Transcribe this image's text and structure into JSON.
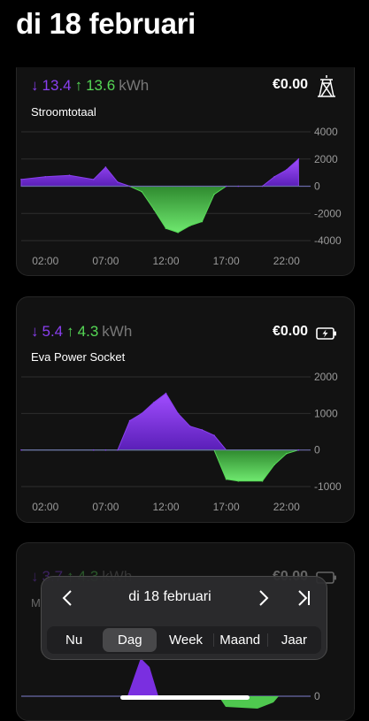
{
  "page": {
    "title": "di 18 februari"
  },
  "cards": [
    {
      "down": "13.4",
      "up": "13.6",
      "unit": "kWh",
      "price": "€0.00",
      "name": "Stroomtotaal",
      "icon": "power-pylon-icon",
      "chart": {
        "yticks": [
          "4000",
          "2000",
          "0",
          "-2000",
          "-4000"
        ],
        "xticks": [
          "02:00",
          "07:00",
          "12:00",
          "17:00",
          "22:00"
        ]
      }
    },
    {
      "down": "5.4",
      "up": "4.3",
      "unit": "kWh",
      "price": "€0.00",
      "name": "Eva Power Socket",
      "icon": "battery-charging-icon",
      "chart": {
        "yticks": [
          "2000",
          "1000",
          "0",
          "-1000"
        ],
        "xticks": [
          "02:00",
          "07:00",
          "12:00",
          "17:00",
          "22:00"
        ]
      }
    },
    {
      "down": "3.7",
      "up": "4.3",
      "unit": "kWh",
      "price": "€0.00",
      "name": "M",
      "icon": "battery-charging-icon",
      "chart": {
        "yticks": [
          "0"
        ]
      }
    }
  ],
  "chart_data": [
    {
      "type": "area",
      "title": "Stroomtotaal",
      "ylim": [
        -4000,
        4000
      ],
      "xlabel": "",
      "ylabel": "",
      "x": [
        "00:00",
        "02:00",
        "04:00",
        "06:00",
        "07:00",
        "08:00",
        "09:00",
        "10:00",
        "11:00",
        "12:00",
        "13:00",
        "14:00",
        "15:00",
        "16:00",
        "17:00",
        "18:00",
        "20:00",
        "21:00",
        "22:00",
        "23:00"
      ],
      "values": [
        500,
        700,
        800,
        500,
        1400,
        300,
        0,
        -400,
        -1700,
        -3100,
        -3400,
        -2900,
        -2600,
        -600,
        0,
        0,
        0,
        700,
        1200,
        2000
      ]
    },
    {
      "type": "area",
      "title": "Eva Power Socket",
      "ylim": [
        -1000,
        2000
      ],
      "xlabel": "",
      "ylabel": "",
      "x": [
        "00:00",
        "06:00",
        "07:00",
        "08:00",
        "09:00",
        "10:00",
        "11:00",
        "12:00",
        "13:00",
        "14:00",
        "15:00",
        "16:00",
        "17:00",
        "18:00",
        "20:00",
        "21:00",
        "22:00",
        "23:00"
      ],
      "values": [
        0,
        0,
        0,
        0,
        800,
        1000,
        1300,
        1550,
        1000,
        650,
        550,
        400,
        -800,
        -850,
        -850,
        -400,
        -100,
        0
      ]
    }
  ],
  "picker": {
    "date": "di 18 februari",
    "segments": [
      "Nu",
      "Dag",
      "Week",
      "Maand",
      "Jaar"
    ],
    "active": "Dag"
  },
  "colors": {
    "import": "#8a3ff0",
    "export": "#55d855",
    "card": "#121212"
  }
}
